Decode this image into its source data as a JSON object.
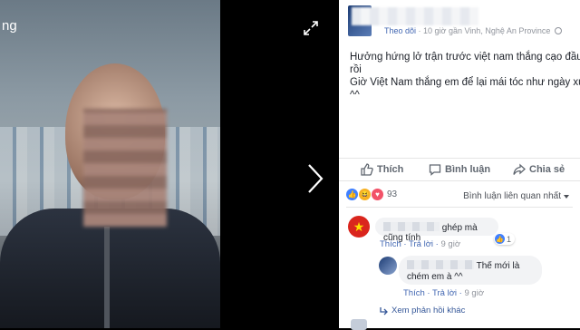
{
  "viewer": {
    "title_partial": "ng"
  },
  "post": {
    "meta_follow": "Theo dõi",
    "meta_rest": " · 10 giờ gần Vinh, Nghệ An Province",
    "text_lines": [
      "Hưởng hứng lở trận trước việt nam thắng cạo đầu",
      "rồi",
      "Giờ Việt Nam thắng em để lại mái tóc như ngày xưa",
      "^^"
    ]
  },
  "actions": {
    "like": "Thích",
    "comment": "Bình luận",
    "share": "Chia sẻ"
  },
  "reactions": {
    "count": "93",
    "sort_label": "Bình luận liên quan nhất"
  },
  "comments": [
    {
      "text": "ghép mà cũng tính",
      "like_count": "1",
      "like": "Thích",
      "reply": "Trả lời",
      "time": "9 giờ"
    },
    {
      "text_line1": "Thế mới là",
      "text_line2": "chém em à ^^",
      "like": "Thích",
      "reply": "Trả lời",
      "time": "9 giờ"
    }
  ],
  "more_replies": "Xem phản hồi khác",
  "colors": {
    "link": "#4267b2",
    "like_blue": "#4080ff",
    "flag_red": "#da251d",
    "flag_star": "#ffdf00"
  }
}
